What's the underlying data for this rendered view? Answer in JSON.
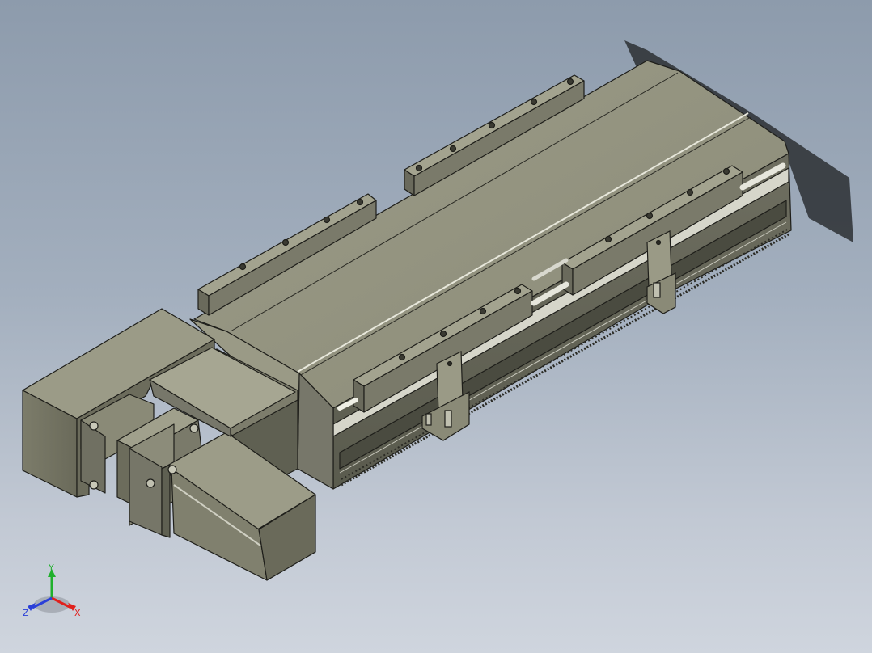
{
  "viewport": {
    "background_top": "#8d9bac",
    "background_bottom": "#cfd5de"
  },
  "model": {
    "body_color": "#8c8c7a",
    "dark_color": "#5f6052",
    "light_color": "#a9a995",
    "edge_color": "#1e1e1a"
  },
  "triad": {
    "x_label": "X",
    "y_label": "Y",
    "z_label": "Z",
    "x_color": "#e0201c",
    "y_color": "#1fb02c",
    "z_color": "#2a3fd8"
  }
}
